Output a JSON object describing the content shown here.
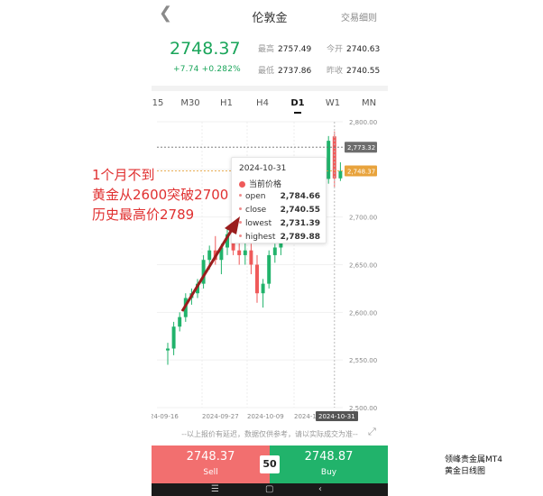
{
  "header": {
    "back_icon": "chevron-left-icon",
    "title": "伦敦金",
    "rules_link": "交易细则"
  },
  "quote": {
    "price": "2748.37",
    "change": "+7.74",
    "change_pct": "+0.282%",
    "high_label": "最高",
    "high": "2757.49",
    "open_label": "今开",
    "open": "2740.63",
    "low_label": "最低",
    "low": "2737.86",
    "prev_close_label": "昨收",
    "prev_close": "2740.55",
    "color_up": "#1aa55a"
  },
  "timeframes": [
    "15",
    "M30",
    "H1",
    "H4",
    "D1",
    "W1",
    "MN"
  ],
  "active_timeframe": "D1",
  "tooltip": {
    "date": "2024-10-31",
    "current_label": "当前价格",
    "rows": [
      {
        "label": "open",
        "value": "2,784.66"
      },
      {
        "label": "close",
        "value": "2,740.55"
      },
      {
        "label": "lowest",
        "value": "2,731.39"
      },
      {
        "label": "highest",
        "value": "2,789.88"
      }
    ]
  },
  "chart_data": {
    "type": "candlestick",
    "y_ticks": [
      "2,800.00",
      "2,750.00",
      "2,700.00",
      "2,650.00",
      "2,600.00",
      "2,550.00",
      "2,500.00"
    ],
    "ylim": [
      2500,
      2800
    ],
    "x_ticks": [
      "24-09-16",
      "2024-09-27",
      "2024-10-09",
      "2024-10-21",
      "2024-10-31"
    ],
    "price_tags": [
      {
        "label": "2,773.32",
        "value": 2773.32,
        "color": "#6d6d6d"
      },
      {
        "label": "2,748.37",
        "value": 2748.37,
        "color": "#e8a33c"
      }
    ],
    "colors": {
      "up": "#21b36b",
      "down": "#ef5a5a"
    },
    "candles": [
      {
        "o": 2560,
        "h": 2568,
        "l": 2545,
        "c": 2562
      },
      {
        "o": 2562,
        "h": 2590,
        "l": 2555,
        "c": 2585
      },
      {
        "o": 2585,
        "h": 2600,
        "l": 2580,
        "c": 2595
      },
      {
        "o": 2595,
        "h": 2620,
        "l": 2590,
        "c": 2615
      },
      {
        "o": 2615,
        "h": 2625,
        "l": 2608,
        "c": 2620
      },
      {
        "o": 2620,
        "h": 2635,
        "l": 2615,
        "c": 2630
      },
      {
        "o": 2630,
        "h": 2660,
        "l": 2625,
        "c": 2655
      },
      {
        "o": 2655,
        "h": 2670,
        "l": 2645,
        "c": 2665
      },
      {
        "o": 2665,
        "h": 2680,
        "l": 2650,
        "c": 2655
      },
      {
        "o": 2655,
        "h": 2672,
        "l": 2640,
        "c": 2668
      },
      {
        "o": 2668,
        "h": 2690,
        "l": 2660,
        "c": 2682
      },
      {
        "o": 2682,
        "h": 2688,
        "l": 2660,
        "c": 2665
      },
      {
        "o": 2665,
        "h": 2680,
        "l": 2650,
        "c": 2660
      },
      {
        "o": 2660,
        "h": 2675,
        "l": 2650,
        "c": 2665
      },
      {
        "o": 2665,
        "h": 2672,
        "l": 2640,
        "c": 2650
      },
      {
        "o": 2650,
        "h": 2660,
        "l": 2610,
        "c": 2620
      },
      {
        "o": 2620,
        "h": 2635,
        "l": 2605,
        "c": 2630
      },
      {
        "o": 2630,
        "h": 2665,
        "l": 2625,
        "c": 2660
      },
      {
        "o": 2660,
        "h": 2672,
        "l": 2652,
        "c": 2668
      },
      {
        "o": 2668,
        "h": 2685,
        "l": 2660,
        "c": 2680
      },
      {
        "o": 2680,
        "h": 2700,
        "l": 2675,
        "c": 2695
      },
      {
        "o": 2695,
        "h": 2715,
        "l": 2690,
        "c": 2710
      },
      {
        "o": 2710,
        "h": 2725,
        "l": 2700,
        "c": 2720
      },
      {
        "o": 2720,
        "h": 2740,
        "l": 2715,
        "c": 2735
      },
      {
        "o": 2735,
        "h": 2745,
        "l": 2725,
        "c": 2730
      },
      {
        "o": 2730,
        "h": 2750,
        "l": 2725,
        "c": 2745
      },
      {
        "o": 2745,
        "h": 2760,
        "l": 2735,
        "c": 2740
      },
      {
        "o": 2740,
        "h": 2785,
        "l": 2735,
        "c": 2780
      },
      {
        "o": 2784.66,
        "h": 2789.88,
        "l": 2731.39,
        "c": 2740.55
      },
      {
        "o": 2740.63,
        "h": 2757.49,
        "l": 2737.86,
        "c": 2748.37
      }
    ]
  },
  "disclaimer": "--以上报价有延迟，数据仅供参考，请以实际成交为准--",
  "trade": {
    "sell_price": "2748.37",
    "sell_label": "Sell",
    "spread": "50",
    "buy_price": "2748.87",
    "buy_label": "Buy"
  },
  "annotation": {
    "lines": [
      "1个月不到",
      "黄金从2600突破2700",
      "历史最高价2789"
    ],
    "color": "#e03030"
  },
  "watermark": {
    "lines": [
      "领峰贵金属MT4",
      "黄金日线图"
    ]
  },
  "navbar": {
    "icons": [
      "menu-icon",
      "home-icon",
      "back-icon"
    ]
  }
}
